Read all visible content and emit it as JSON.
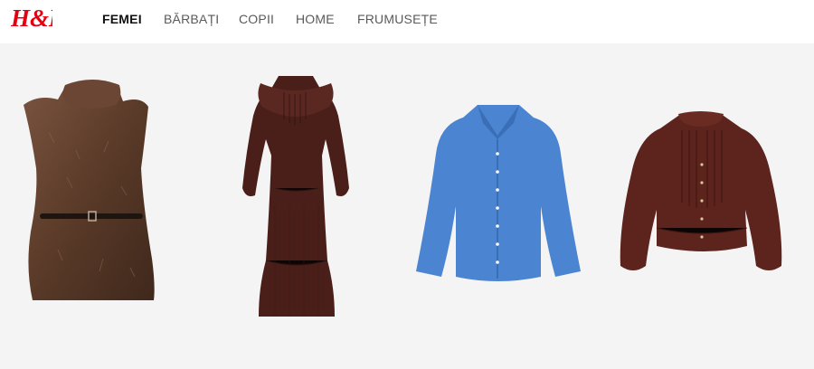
{
  "brand": {
    "logo_text": "H&M",
    "color": "#e50010"
  },
  "nav": {
    "items": [
      {
        "label": "FEMEI",
        "active": true
      },
      {
        "label": "BĂRBAȚI",
        "active": false
      },
      {
        "label": "COPII",
        "active": false
      },
      {
        "label": "HOME",
        "active": false
      },
      {
        "label": "FRUMUSEȚE",
        "active": false
      }
    ]
  },
  "gallery": {
    "background": "#f4f4f4",
    "products": [
      {
        "icon": "fur-vest-dress-image",
        "color": "#5a3a28"
      },
      {
        "icon": "ruffle-maxi-dress-image",
        "color": "#4a1f1a"
      },
      {
        "icon": "blue-shirt-image",
        "color": "#4b84d0"
      },
      {
        "icon": "pleated-blouse-image",
        "color": "#5c241c"
      }
    ]
  }
}
